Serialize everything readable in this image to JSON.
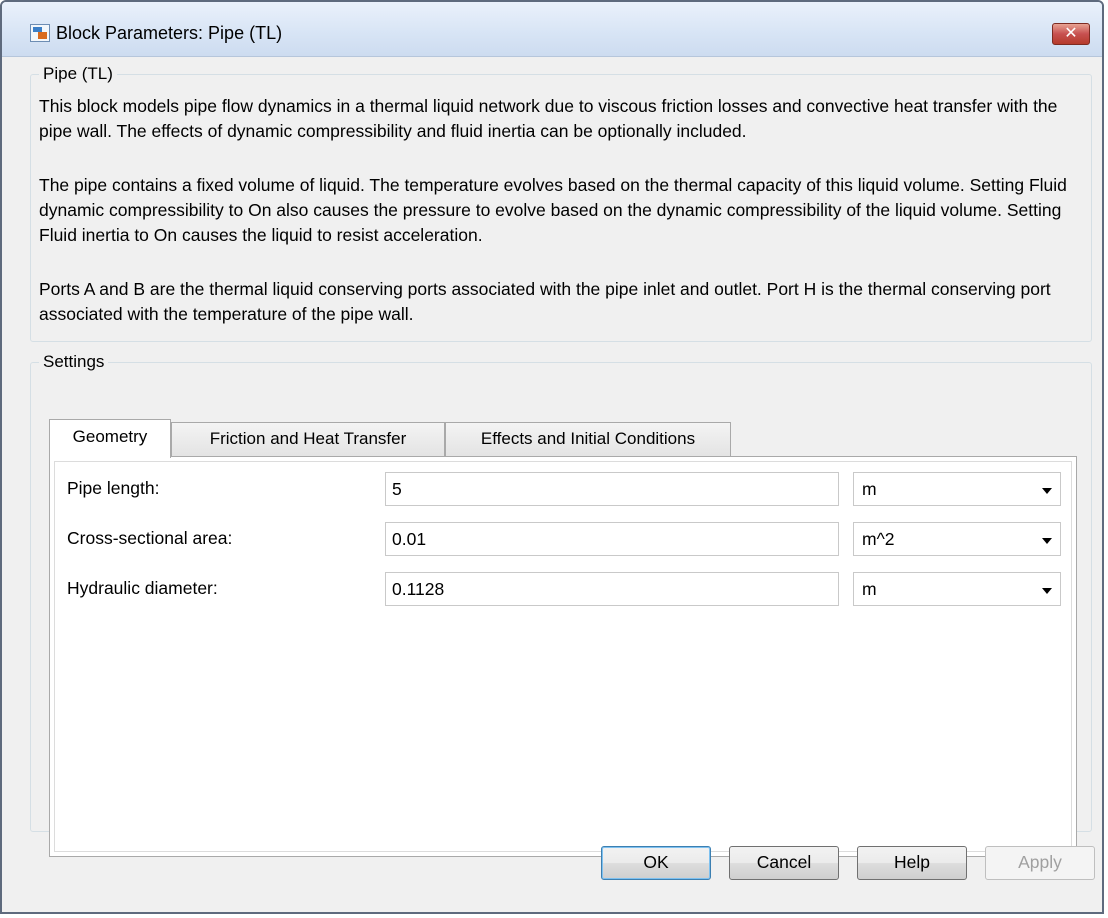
{
  "window": {
    "title": "Block Parameters: Pipe (TL)",
    "close_glyph": "✕"
  },
  "description_group": {
    "legend": "Pipe (TL)",
    "paragraphs": [
      "This block models pipe flow dynamics in a thermal liquid network due to viscous friction losses and convective heat transfer with the pipe wall. The effects of dynamic compressibility and fluid inertia can be optionally included.",
      "The pipe contains a fixed volume of liquid. The temperature evolves based on the thermal capacity of this liquid volume. Setting Fluid dynamic compressibility to On also causes the pressure to evolve based on the dynamic compressibility of the liquid volume. Setting Fluid inertia to On causes the liquid to resist acceleration.",
      "Ports A and B are the thermal liquid conserving ports associated with the pipe inlet and outlet. Port H is the thermal conserving port associated with the temperature of the pipe wall."
    ]
  },
  "settings": {
    "legend": "Settings",
    "tabs": [
      {
        "label": "Geometry",
        "active": true
      },
      {
        "label": "Friction and Heat Transfer",
        "active": false
      },
      {
        "label": "Effects and Initial Conditions",
        "active": false
      }
    ],
    "parameters": [
      {
        "label": "Pipe length:",
        "value": "5",
        "unit": "m"
      },
      {
        "label": "Cross-sectional area:",
        "value": "0.01",
        "unit": "m^2"
      },
      {
        "label": "Hydraulic diameter:",
        "value": "0.1128",
        "unit": "m"
      }
    ]
  },
  "buttons": {
    "ok": "OK",
    "cancel": "Cancel",
    "help": "Help",
    "apply": "Apply"
  },
  "icons": {
    "app": "simulink-block-icon",
    "close": "close-icon",
    "dropdown": "chevron-down-icon"
  }
}
